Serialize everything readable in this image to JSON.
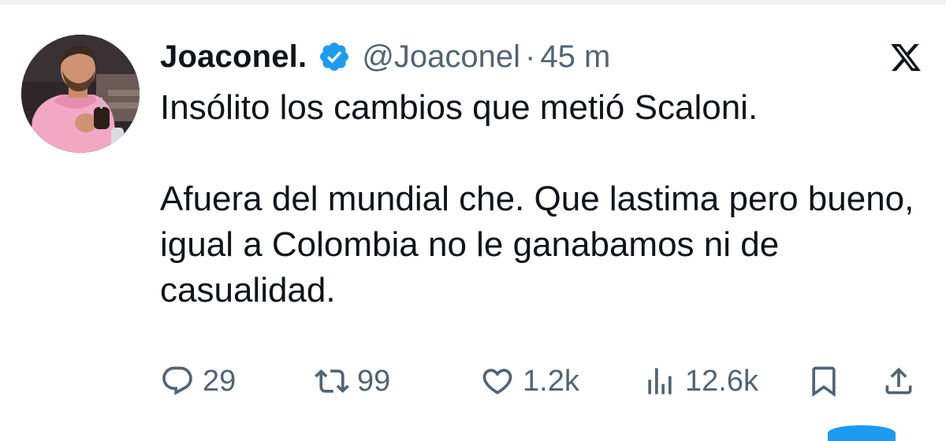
{
  "tweet": {
    "author_name": "Joaconel.",
    "verified": true,
    "handle": "@Joaconel",
    "separator": "·",
    "time": "45 m",
    "paragraphs": [
      "Insólito los cambios que metió Scaloni.",
      "Afuera del mundial che. Que lastima pero bueno, igual a Colombia no le ganabamos ni de casualidad."
    ],
    "actions": {
      "replies": "29",
      "retweets": "99",
      "likes": "1.2k",
      "views": "12.6k"
    }
  },
  "icons": {
    "verified": "verified-badge-icon",
    "platform": "x-logo-icon",
    "reply": "reply-icon",
    "retweet": "retweet-icon",
    "like": "heart-icon",
    "views": "views-icon",
    "bookmark": "bookmark-icon",
    "share": "share-icon"
  },
  "colors": {
    "text_primary": "#0f1419",
    "text_secondary": "#536471",
    "verified_blue": "#1d9bf0",
    "divider": "#eff3f4"
  }
}
